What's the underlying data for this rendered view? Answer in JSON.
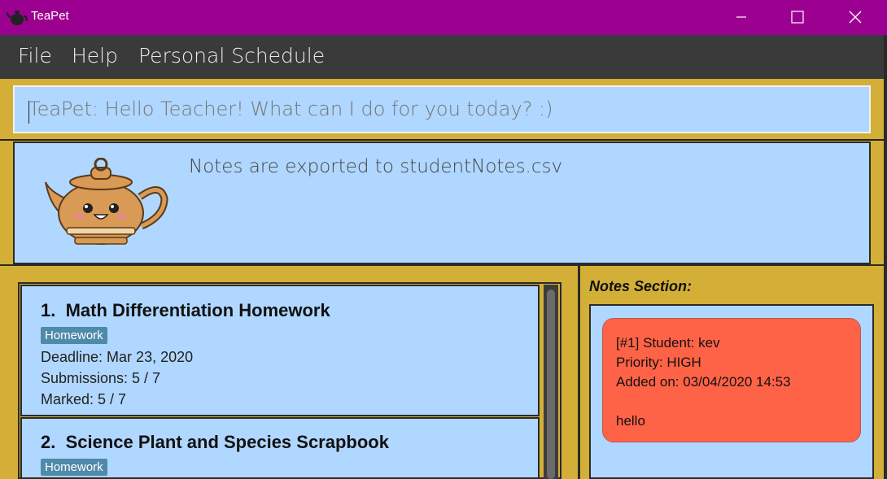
{
  "window": {
    "title": "TeaPet",
    "minimize": "—",
    "maximize": "☐",
    "close": "✕"
  },
  "menu": {
    "file": "File",
    "help": "Help",
    "schedule": "Personal Schedule"
  },
  "command": {
    "placeholder": "TeaPet: Hello Teacher! What can I do for you today? :)"
  },
  "result": {
    "message": "Notes are exported to studentNotes.csv"
  },
  "assignments": [
    {
      "index": "1.",
      "title": "Math Differentiation Homework",
      "tag": "Homework",
      "deadline": "Deadline: Mar 23, 2020",
      "submissions": "Submissions: 5 / 7",
      "marked": "Marked: 5 / 7"
    },
    {
      "index": "2.",
      "title": "Science Plant and Species Scrapbook",
      "tag": "Homework"
    }
  ],
  "notes": {
    "heading": "Notes Section:",
    "items": [
      {
        "header": "[#1] Student: kev",
        "priority": "Priority: HIGH",
        "added": "Added on: 03/04/2020 14:53",
        "content": "hello",
        "color": "#ff6347"
      }
    ]
  },
  "colors": {
    "titlebar": "#9c0090",
    "menubar": "#3a3a3a",
    "background": "#d4af37",
    "panel": "#b0d7ff",
    "tag": "#4f8aa8"
  }
}
